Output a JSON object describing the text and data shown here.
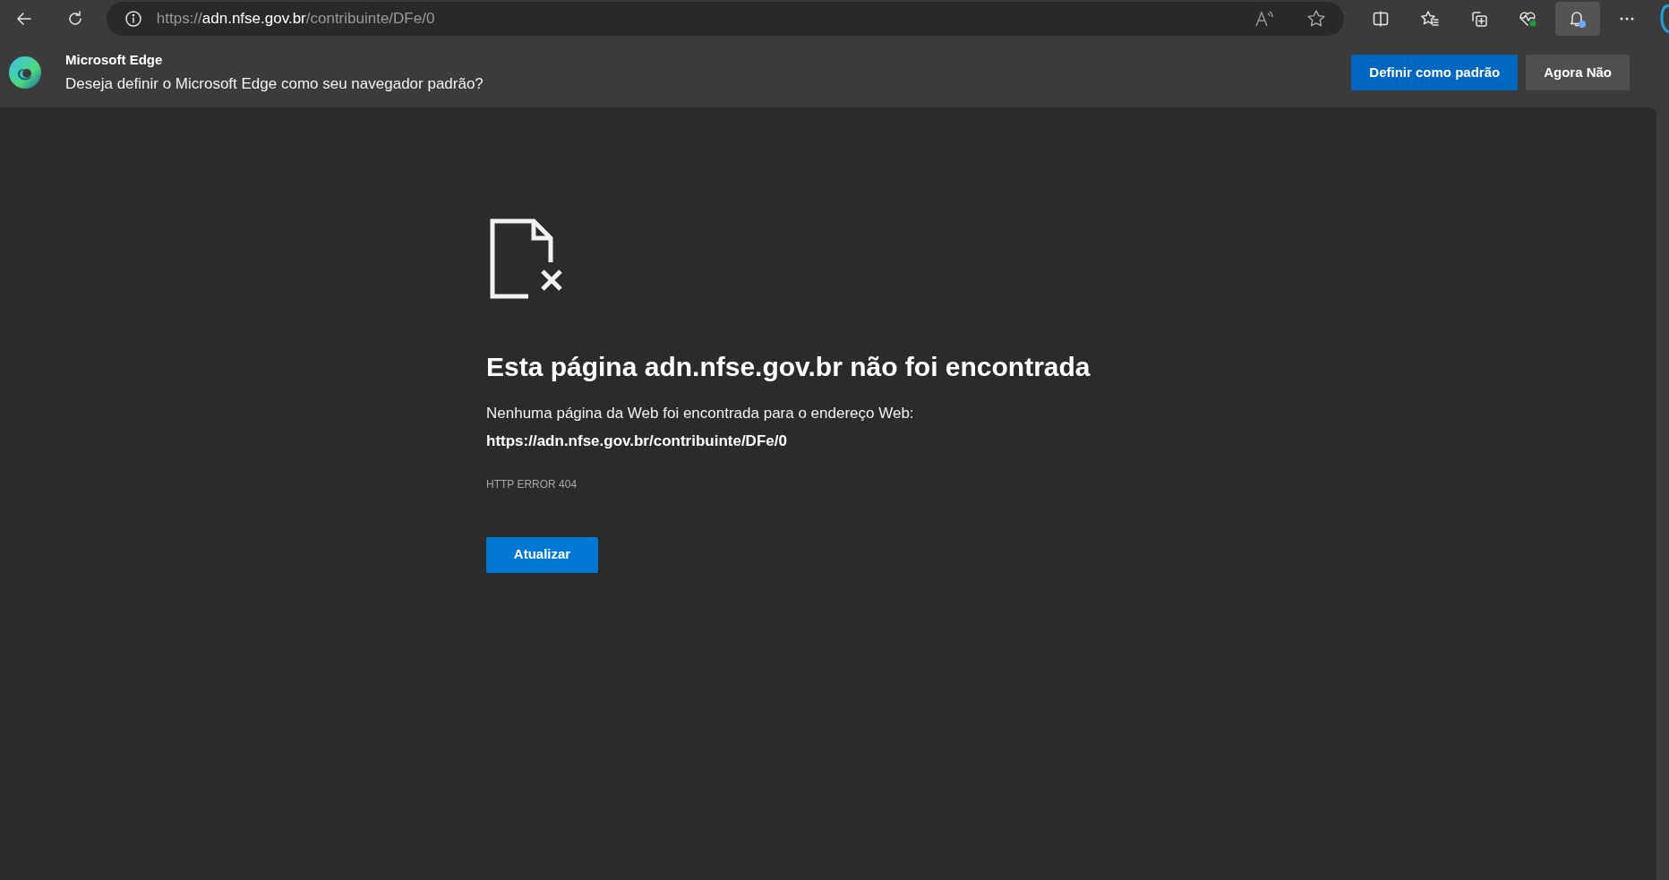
{
  "address_bar": {
    "scheme": "https://",
    "host": "adn.nfse.gov.br",
    "path": "/contribuinte/DFe/0"
  },
  "toolbar": [
    {
      "kind": "split",
      "selected": false
    },
    {
      "kind": "favorites",
      "selected": false
    },
    {
      "kind": "collections",
      "selected": false
    },
    {
      "kind": "health",
      "selected": false
    },
    {
      "kind": "bell",
      "selected": true
    },
    {
      "kind": "more",
      "selected": false
    }
  ],
  "infobar": {
    "title": "Microsoft Edge",
    "message": "Deseja definir o Microsoft Edge como seu navegador padrão?",
    "buttons": [
      {
        "label": "Definir como padrão",
        "primary": true
      },
      {
        "label": "Agora Não",
        "primary": false
      }
    ]
  },
  "error_page": {
    "heading": "Esta página adn.nfse.gov.br não foi encontrada",
    "message": "Nenhuma página da Web foi encontrada para o endereço Web:",
    "url": "https://adn.nfse.gov.br/contribuinte/DFe/0",
    "code": "HTTP ERROR 404",
    "button": "Atualizar"
  }
}
